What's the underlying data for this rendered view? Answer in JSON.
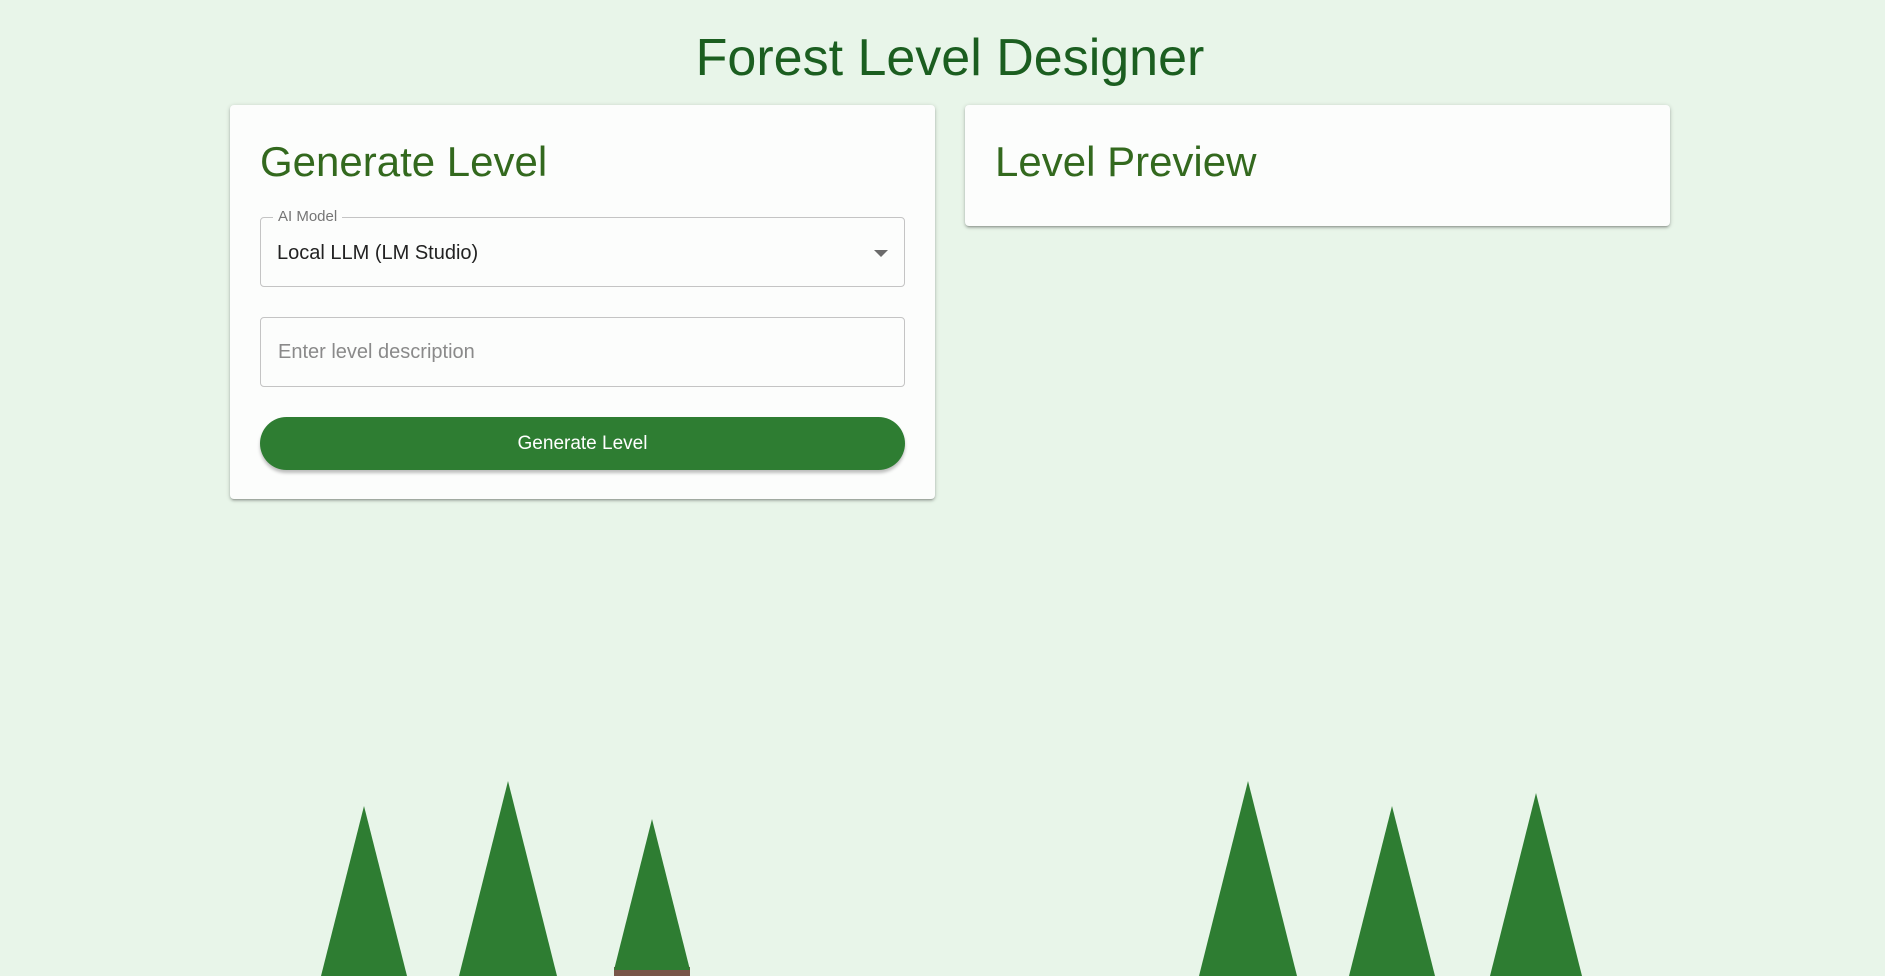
{
  "page": {
    "title": "Forest Level Designer",
    "background_color": "#e8f5e9",
    "title_color": "#1b5e20"
  },
  "generate_panel": {
    "title": "Generate Level",
    "model_select": {
      "label": "AI Model",
      "selected_value": "Local LLM (LM Studio)",
      "icon": "chevron-down-icon"
    },
    "description_input": {
      "value": "",
      "placeholder": "Enter level description"
    },
    "generate_button_label": "Generate Level",
    "button_color": "#2e7d32"
  },
  "preview_panel": {
    "title": "Level Preview"
  },
  "decorations": {
    "tree_color": "#2e7d32",
    "trunk_color": "#795548",
    "tree_count": 6
  }
}
